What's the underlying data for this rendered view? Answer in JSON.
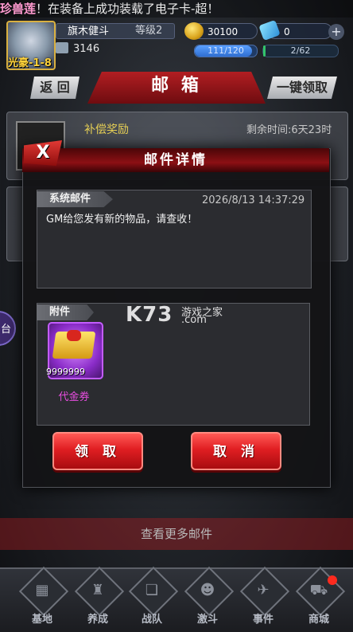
{
  "marquee": {
    "prefix": "珍兽莲",
    "text": "！在装备上成功装载了电子卡-超！"
  },
  "player": {
    "name": "旗木健斗",
    "rank": "等级2",
    "avatar_level": "光豪-1-8",
    "power": "3146",
    "gold": "30100",
    "gems": "0",
    "stamina": {
      "current": 111,
      "max": 120,
      "label": "111/120"
    },
    "exp": {
      "current": 2,
      "max": 62,
      "label": "2/62"
    }
  },
  "mailbox": {
    "title": "邮 箱",
    "back_label": "返 回",
    "claim_all_label": "一键领取",
    "bg_mail": {
      "title": "补偿奖励",
      "time_left": "剩余时间:6天23时"
    },
    "more_mail_label": "查看更多邮件"
  },
  "modal": {
    "title": "邮件详情",
    "close_label": "X",
    "system_tab_label": "系统邮件",
    "date": "2026/8/13 14:37:29",
    "body": "GM给您发有新的物品，请查收！",
    "attachment_tab_label": "附件",
    "item": {
      "name": "代金券",
      "count": "9999999"
    },
    "claim_label": "领 取",
    "cancel_label": "取 消"
  },
  "watermark": {
    "brand": "K73",
    "line1": "游戏之家",
    "line2": ".com"
  },
  "side_tab_label": "台",
  "nav": [
    {
      "label": "基地",
      "icon": "base-icon",
      "glyph": "▦"
    },
    {
      "label": "养成",
      "icon": "train-icon",
      "glyph": "♜"
    },
    {
      "label": "战队",
      "icon": "team-icon",
      "glyph": "❏"
    },
    {
      "label": "激斗",
      "icon": "battle-icon",
      "glyph": "☻"
    },
    {
      "label": "事件",
      "icon": "event-icon",
      "glyph": "✈"
    },
    {
      "label": "商城",
      "icon": "shop-icon",
      "glyph": "⛟"
    }
  ],
  "colors": {
    "accent_red": "#c8161b",
    "gold": "#e6cf55",
    "item_purple": "#8a2cc8",
    "item_name": "#e84de0"
  }
}
